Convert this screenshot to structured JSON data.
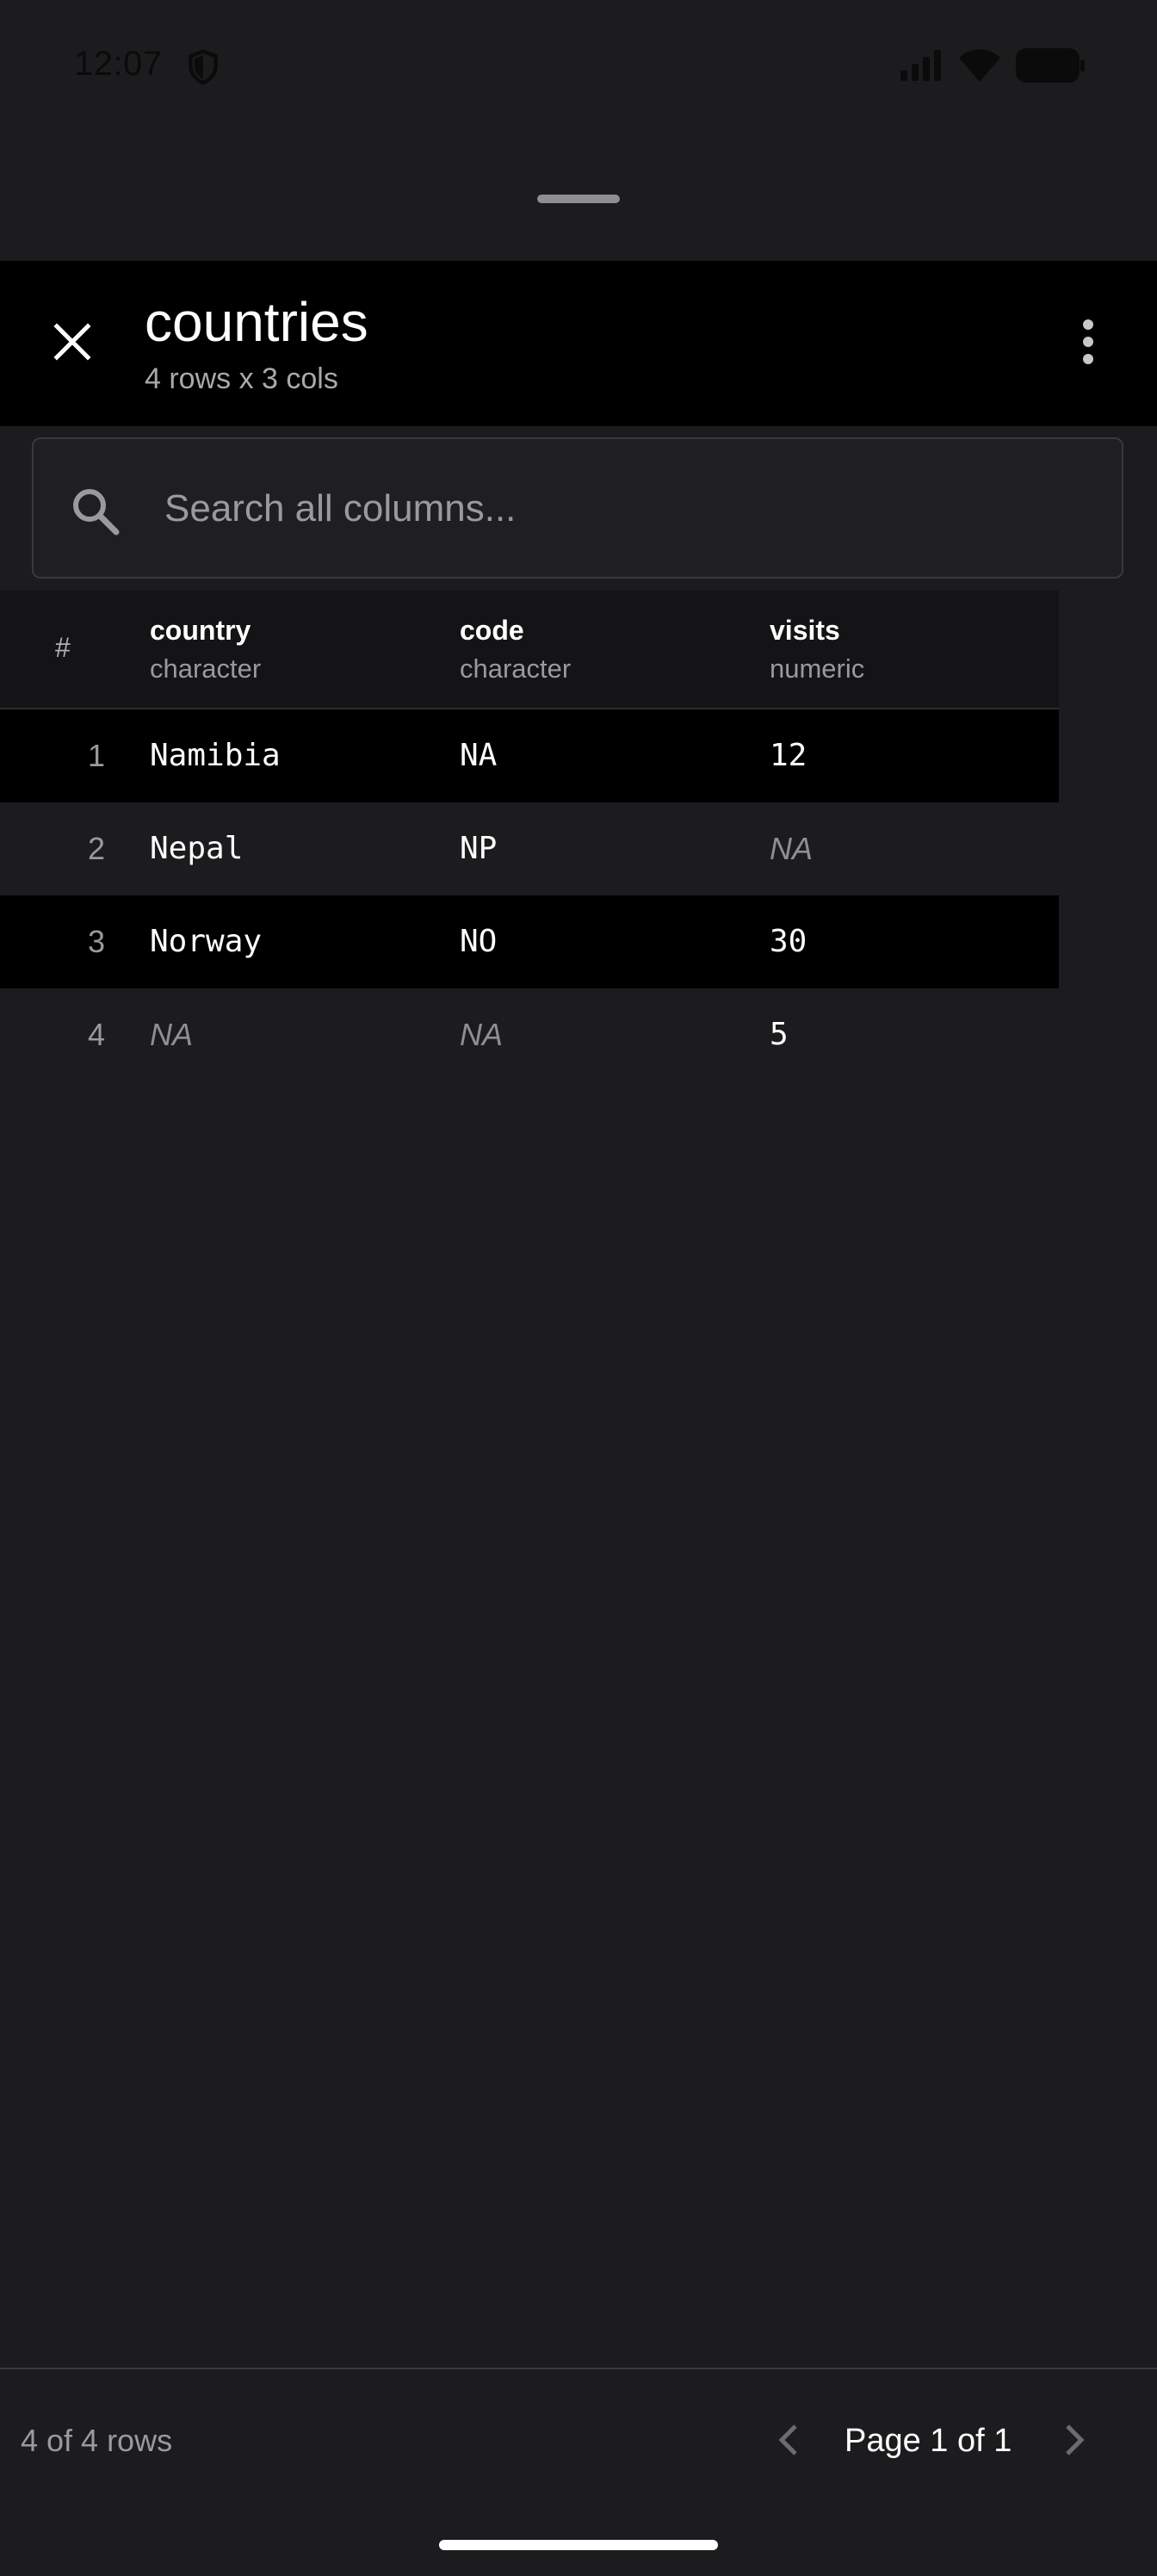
{
  "status_bar": {
    "time": "12:07",
    "icons": [
      "shield-icon",
      "signal-icon",
      "wifi-icon",
      "battery-icon"
    ]
  },
  "header": {
    "title": "countries",
    "subtitle": "4 rows x 3 cols",
    "close_icon": "close-icon",
    "menu_icon": "more-vert-icon"
  },
  "search": {
    "placeholder": "Search all columns...",
    "value": ""
  },
  "table": {
    "index_header": "#",
    "columns": [
      {
        "name": "country",
        "type": "character"
      },
      {
        "name": "code",
        "type": "character"
      },
      {
        "name": "visits",
        "type": "numeric"
      }
    ],
    "rows": [
      {
        "index": "1",
        "cells": [
          "Namibia",
          "NA",
          "12"
        ],
        "na": [
          false,
          false,
          false
        ]
      },
      {
        "index": "2",
        "cells": [
          "Nepal",
          "NP",
          "NA"
        ],
        "na": [
          false,
          false,
          true
        ]
      },
      {
        "index": "3",
        "cells": [
          "Norway",
          "NO",
          "30"
        ],
        "na": [
          false,
          false,
          false
        ]
      },
      {
        "index": "4",
        "cells": [
          "NA",
          "NA",
          "5"
        ],
        "na": [
          true,
          true,
          false
        ]
      }
    ]
  },
  "footer": {
    "row_count": "4 of 4 rows",
    "page_label": "Page 1 of 1"
  },
  "colors": {
    "background": "#1c1c1e",
    "header_bg": "#000000",
    "text": "#ffffff",
    "muted": "#9a9a9e"
  }
}
